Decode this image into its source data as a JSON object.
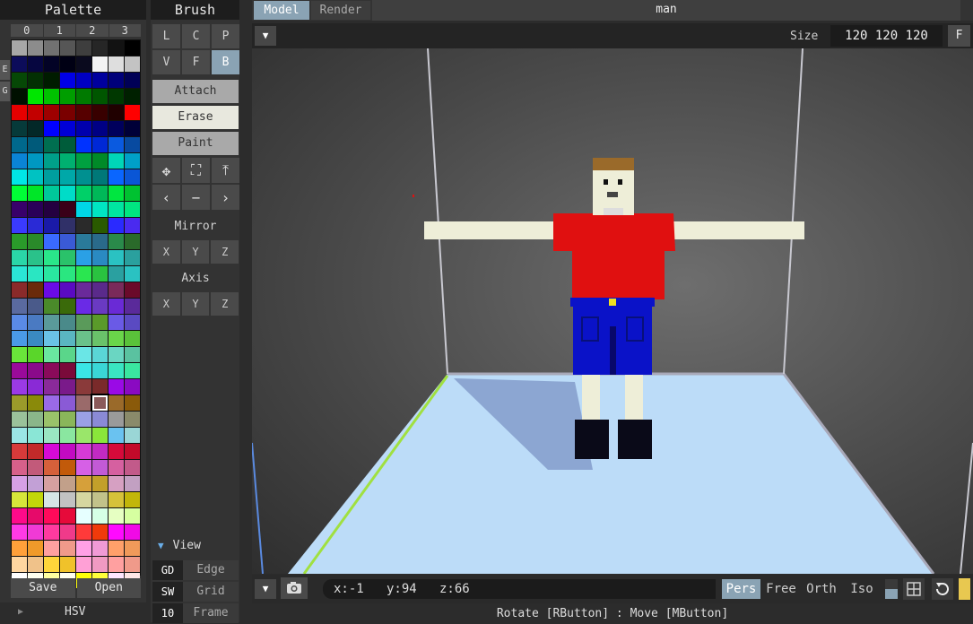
{
  "palette": {
    "title": "Palette",
    "tabs": [
      "0",
      "1",
      "2",
      "3"
    ],
    "side_tabs": [
      "E",
      "G"
    ],
    "save_label": "Save",
    "open_label": "Open",
    "hsv_label": "HSV",
    "selected_index": 181,
    "colors": [
      "#a7a7a7",
      "#8c8c8c",
      "#717171",
      "#565656",
      "#3e3e3e",
      "#262626",
      "#121212",
      "#000000",
      "#0c0c5a",
      "#060640",
      "#030326",
      "#000014",
      "#0a0a1e",
      "#f4f4f4",
      "#dedede",
      "#c3c3c3",
      "#064806",
      "#033003",
      "#001c00",
      "#0000e6",
      "#0000c2",
      "#00009e",
      "#00007a",
      "#000056",
      "#001000",
      "#00e600",
      "#00c200",
      "#009e00",
      "#007a00",
      "#005600",
      "#003800",
      "#002000",
      "#e60000",
      "#c20000",
      "#9e0000",
      "#7a0000",
      "#560000",
      "#380000",
      "#200000",
      "#ff0000",
      "#063a3a",
      "#032828",
      "#0000ff",
      "#0000d6",
      "#0000ad",
      "#000084",
      "#00005c",
      "#000038",
      "#00688c",
      "#005a7a",
      "#006e50",
      "#005c3a",
      "#0032ff",
      "#0028d6",
      "#0a5ae0",
      "#084aa0",
      "#0a84d6",
      "#0098c2",
      "#00a08a",
      "#00b070",
      "#00a040",
      "#008a28",
      "#00d6b8",
      "#00a0c8",
      "#00e6e6",
      "#00c2c2",
      "#009e9e",
      "#00a8a8",
      "#009090",
      "#007878",
      "#0a66ff",
      "#0a56d6",
      "#00ff36",
      "#00e628",
      "#00c89a",
      "#00dcc8",
      "#00d068",
      "#00b858",
      "#00e640",
      "#00c230",
      "#38006a",
      "#2a0058",
      "#240040",
      "#3a0018",
      "#00d6e6",
      "#00e6c2",
      "#00e6a0",
      "#00e680",
      "#3a3aff",
      "#2a2ad6",
      "#1a1aa8",
      "#303068",
      "#2a2a2a",
      "#2a5a00",
      "#2a2aff",
      "#4a2af0",
      "#2a9a2a",
      "#2a8a2a",
      "#3a6aff",
      "#3a5ad6",
      "#2a7a9a",
      "#2a6a8a",
      "#2a8a4a",
      "#2a6a2a",
      "#2ad6a8",
      "#2ac28a",
      "#2ae68a",
      "#2ac26a",
      "#2aa0e6",
      "#2a8ac2",
      "#2ac2c2",
      "#2aa09e",
      "#2ae6d6",
      "#2ae6c2",
      "#2ae6a0",
      "#2ae680",
      "#2ae650",
      "#2ac240",
      "#2aa0a0",
      "#2ac2c2",
      "#8a2a2a",
      "#6a2a0a",
      "#6a0ae6",
      "#5a0ac2",
      "#6a2a9a",
      "#5a2a8a",
      "#7a2a5a",
      "#6a0a2a",
      "#5a6aa0",
      "#4a5a8a",
      "#4a8a2a",
      "#3a6a0a",
      "#6a2ae6",
      "#6a3ac2",
      "#6a2ad6",
      "#5a2a9a",
      "#5a8ae6",
      "#4a7ac2",
      "#5a9a9a",
      "#4a8a8a",
      "#5a9a5a",
      "#5a9a2a",
      "#6a5ae6",
      "#5a4ac2",
      "#4a9ae6",
      "#3a8ac2",
      "#6ac2e6",
      "#5ab6c2",
      "#6ac28a",
      "#6ac26a",
      "#6ad64a",
      "#5ac23a",
      "#6ae63a",
      "#5ad62a",
      "#6ae6a0",
      "#5ad68a",
      "#6ae6e6",
      "#5ad6d6",
      "#6ad6c2",
      "#5ac2a0",
      "#9a0a9a",
      "#8a0a8a",
      "#8a0a5a",
      "#7a0a3a",
      "#3ae6e6",
      "#3ad6d6",
      "#3ae6c2",
      "#3ae6a0",
      "#9a3ae6",
      "#8a2ad6",
      "#8a2a9a",
      "#7a1a8a",
      "#8a3a3a",
      "#7a2a2a",
      "#9a0ae6",
      "#8a0ac2",
      "#9a9a2a",
      "#8a8a0a",
      "#9a6ae6",
      "#8a5ad6",
      "#9a6a6a",
      "#8a5a5a",
      "#9a6a2a",
      "#8a5a0a",
      "#9ac29a",
      "#8ab68a",
      "#9ac26a",
      "#8ab65a",
      "#9aa0e6",
      "#8a8ad6",
      "#9a9a9a",
      "#8a8a6a",
      "#9ae6e6",
      "#8ae6d6",
      "#9ae6c2",
      "#8ae6a0",
      "#9ae66a",
      "#8ae63a",
      "#6ac2f0",
      "#9ad6d6",
      "#d63a3a",
      "#c22a2a",
      "#d60ad6",
      "#c20ac2",
      "#d63ad6",
      "#c22ac2",
      "#d60a3a",
      "#c20a2a",
      "#d6608a",
      "#c25a7a",
      "#d6603a",
      "#c25a0a",
      "#d660e6",
      "#c25ad6",
      "#d660a0",
      "#c25a8a",
      "#d6a0e6",
      "#c2a0d6",
      "#d6a0a0",
      "#c2a08a",
      "#d6a03a",
      "#c2a02a",
      "#d6a0c2",
      "#c2a0c2",
      "#d6e63a",
      "#c2d60a",
      "#d6e6e6",
      "#c2c2c2",
      "#d6d6a0",
      "#c2c28a",
      "#d6c23a",
      "#c2b60a",
      "#ff0a8a",
      "#e60a6a",
      "#ff0a5a",
      "#e60a3a",
      "#e6ffff",
      "#d6ffe6",
      "#e6ffc2",
      "#d6ffa0",
      "#ff3ae6",
      "#f03ad6",
      "#ff3aa0",
      "#f03a8a",
      "#ff3a3a",
      "#f03a0a",
      "#ff0aff",
      "#f00ae6",
      "#ffa03a",
      "#f09a2a",
      "#ffa0a0",
      "#f09a8a",
      "#ffa0e6",
      "#f09ad6",
      "#ffa06a",
      "#f09a5a",
      "#ffd6a0",
      "#f0c28a",
      "#ffd63a",
      "#f0c22a",
      "#ffa0d6",
      "#f09ac2",
      "#ffa0a0",
      "#f09a8a",
      "#ffffff",
      "#fffff0",
      "#ffffa0",
      "#fffff0",
      "#ffff0a",
      "#ffff3a",
      "#ffe6ff",
      "#ffe6e6"
    ]
  },
  "brush": {
    "title": "Brush",
    "modes": [
      "L",
      "C",
      "P",
      "V",
      "F",
      "B"
    ],
    "active_mode": "B",
    "ops": [
      "Attach",
      "Erase",
      "Paint"
    ],
    "active_op": "Erase",
    "mirror_label": "Mirror",
    "axis_label": "Axis",
    "xyz": [
      "X",
      "Y",
      "Z"
    ],
    "view_label": "View",
    "view_rows": [
      {
        "key": "GD",
        "label": "Edge"
      },
      {
        "key": "SW",
        "label": "Grid"
      },
      {
        "key": "10",
        "label": "Frame"
      }
    ]
  },
  "viewport": {
    "tabs": [
      "Model",
      "Render"
    ],
    "active_tab": "Model",
    "title": "man",
    "size_label": "Size",
    "size_value": "120 120 120",
    "f_label": "F",
    "coords": "x:-1   y:94   z:66",
    "projections": [
      "Pers",
      "Free",
      "Orth",
      "Iso"
    ],
    "active_projection": "Pers",
    "status": "Rotate [RButton] : Move [MButton]"
  },
  "icons": {
    "dropdown": "triangle-down-icon",
    "camera": "camera-icon",
    "move": "move-arrows-icon",
    "fit": "fit-frame-icon",
    "upload": "arrow-up-bar-icon",
    "prev": "chevron-left-icon",
    "minus": "minus-icon",
    "next": "chevron-right-icon",
    "reset": "rotate-reset-icon"
  },
  "scene": {
    "shirt_color": "#e01010",
    "pants_color": "#0a12c8",
    "skin_color": "#eeeed8",
    "hair_color": "#9a6a2a",
    "shoe_color": "#0a0a18",
    "floor_color": "#bcdcf8",
    "accent_line": "#a0e040"
  }
}
